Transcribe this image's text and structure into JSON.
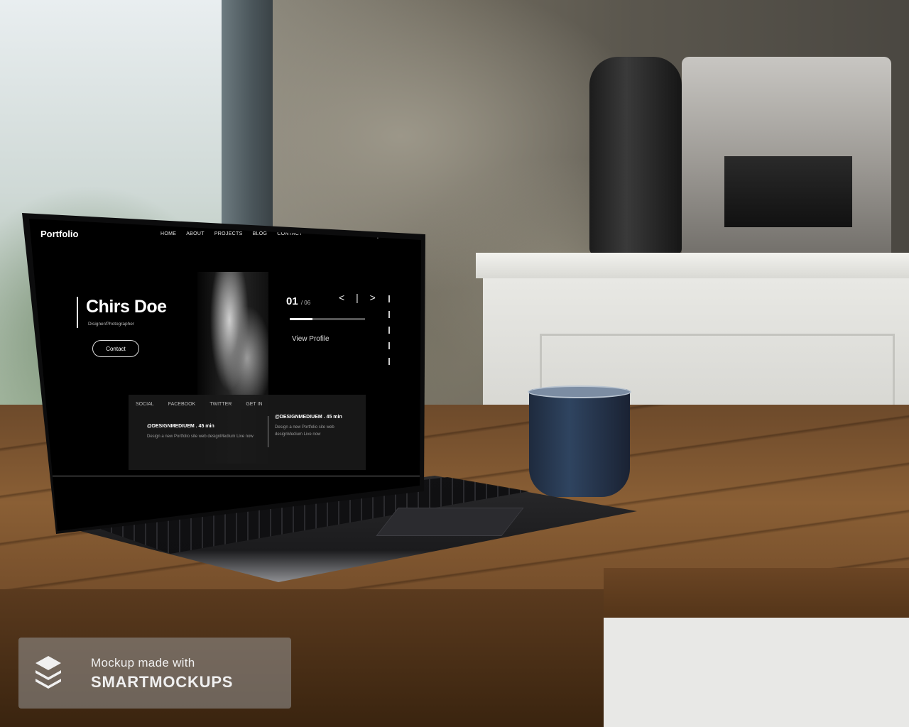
{
  "screen": {
    "logo": "Portfolio",
    "nav": [
      "HOME",
      "ABOUT",
      "PROJECTS",
      "BLOG",
      "CONTACT"
    ],
    "hero": {
      "name": "Chirs Doe",
      "role": "Disigner/Photographer",
      "contact_button": "Contact"
    },
    "slider": {
      "current": "01",
      "total": "/ 06",
      "arrows": "< | >",
      "progress": 0.3,
      "view_profile": "View Profile"
    },
    "social": {
      "labels": [
        "SOCIAL",
        "FACEBOOK",
        "TWITTER",
        "GET IN"
      ],
      "tweets": [
        {
          "handle": "@DESIGNMEDIUEM . 45 min",
          "text": "Design a new Portfolio site web designMedium Live now"
        },
        {
          "handle": "@DESIGNMEDIUEM . 45 min",
          "text": "Design a new Portfolio site web designMedium Live now"
        }
      ]
    }
  },
  "watermark": {
    "line1": "Mockup made with",
    "line2": "SMARTMOCKUPS"
  }
}
